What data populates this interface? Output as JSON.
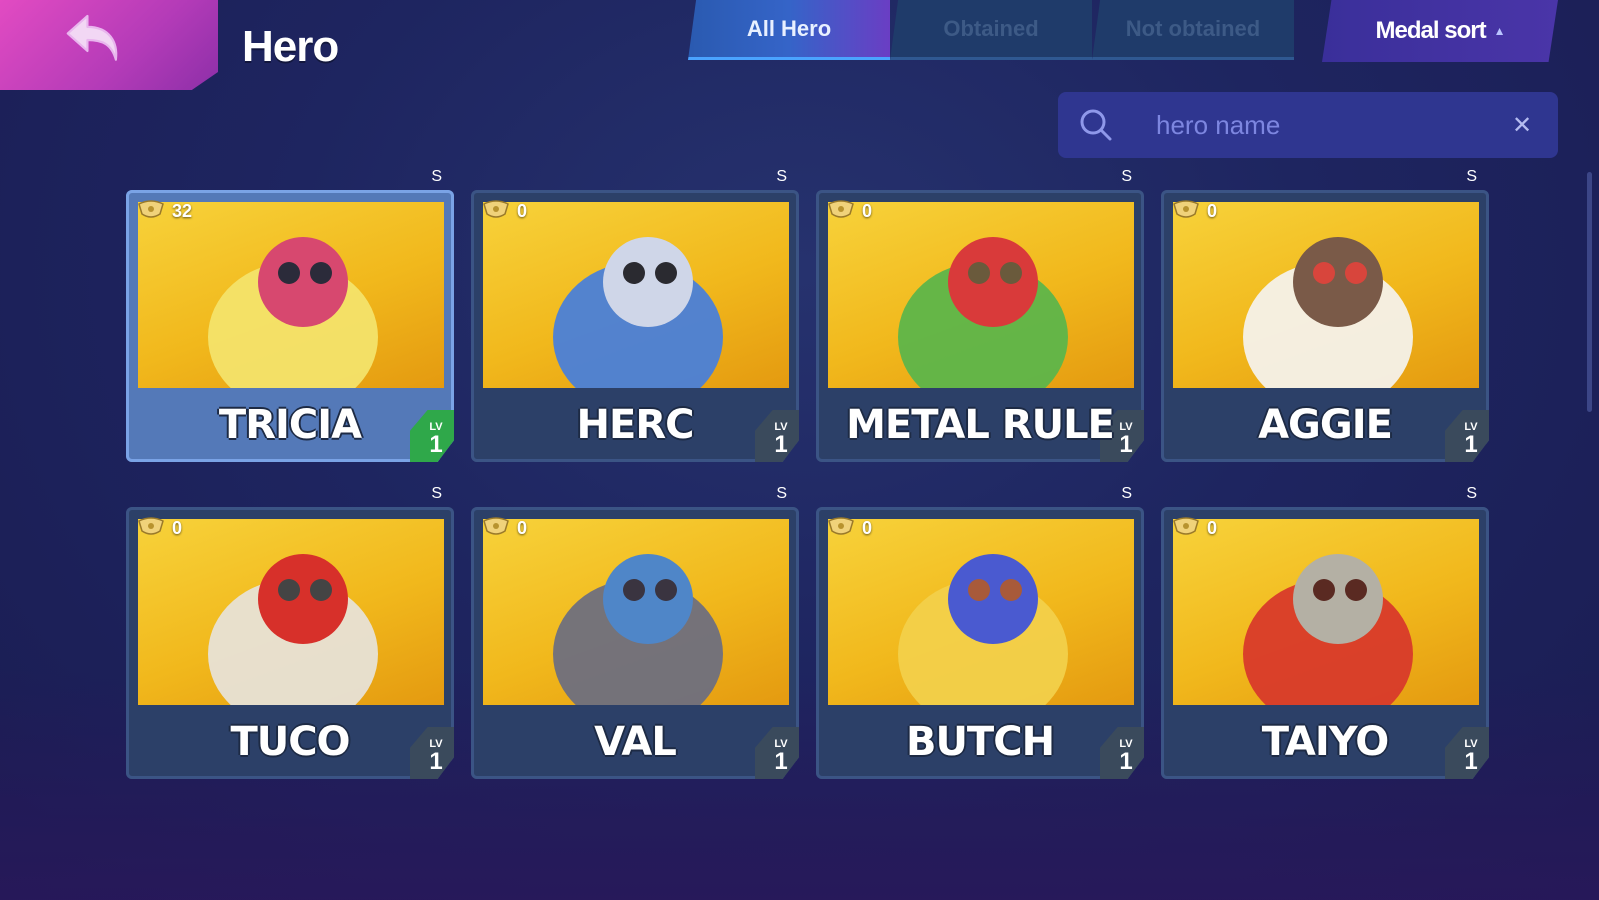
{
  "header": {
    "title": "Hero",
    "tabs": [
      {
        "label": "All Hero",
        "active": true
      },
      {
        "label": "Obtained",
        "active": false
      },
      {
        "label": "Not obtained",
        "active": false
      }
    ],
    "sort_label": "Medal sort"
  },
  "search": {
    "placeholder": "hero name"
  },
  "heroes": [
    {
      "name": "TRICIA",
      "medals": "32",
      "rank": "S",
      "lv_label": "LV",
      "level": "1",
      "selected": true
    },
    {
      "name": "HERC",
      "medals": "0",
      "rank": "S",
      "lv_label": "LV",
      "level": "1",
      "selected": false
    },
    {
      "name": "METAL RULE",
      "medals": "0",
      "rank": "S",
      "lv_label": "LV",
      "level": "1",
      "selected": false
    },
    {
      "name": "AGGIE",
      "medals": "0",
      "rank": "S",
      "lv_label": "LV",
      "level": "1",
      "selected": false
    },
    {
      "name": "TUCO",
      "medals": "0",
      "rank": "S",
      "lv_label": "LV",
      "level": "1",
      "selected": false
    },
    {
      "name": "VAL",
      "medals": "0",
      "rank": "S",
      "lv_label": "LV",
      "level": "1",
      "selected": false
    },
    {
      "name": "BUTCH",
      "medals": "0",
      "rank": "S",
      "lv_label": "LV",
      "level": "1",
      "selected": false
    },
    {
      "name": "TAIYO",
      "medals": "0",
      "rank": "S",
      "lv_label": "LV",
      "level": "1",
      "selected": false
    }
  ],
  "colors": {
    "background": "#1e2560",
    "back_button": "#c740bb",
    "active_tab": "#3564c8",
    "rank_s": "#d4ef2a",
    "selected_level_badge": "#2fa84a"
  },
  "icons": {
    "back": "back-arrow-icon",
    "search": "search-icon",
    "clear": "close-icon",
    "medal": "medal-icon",
    "sort": "caret-up-icon"
  }
}
